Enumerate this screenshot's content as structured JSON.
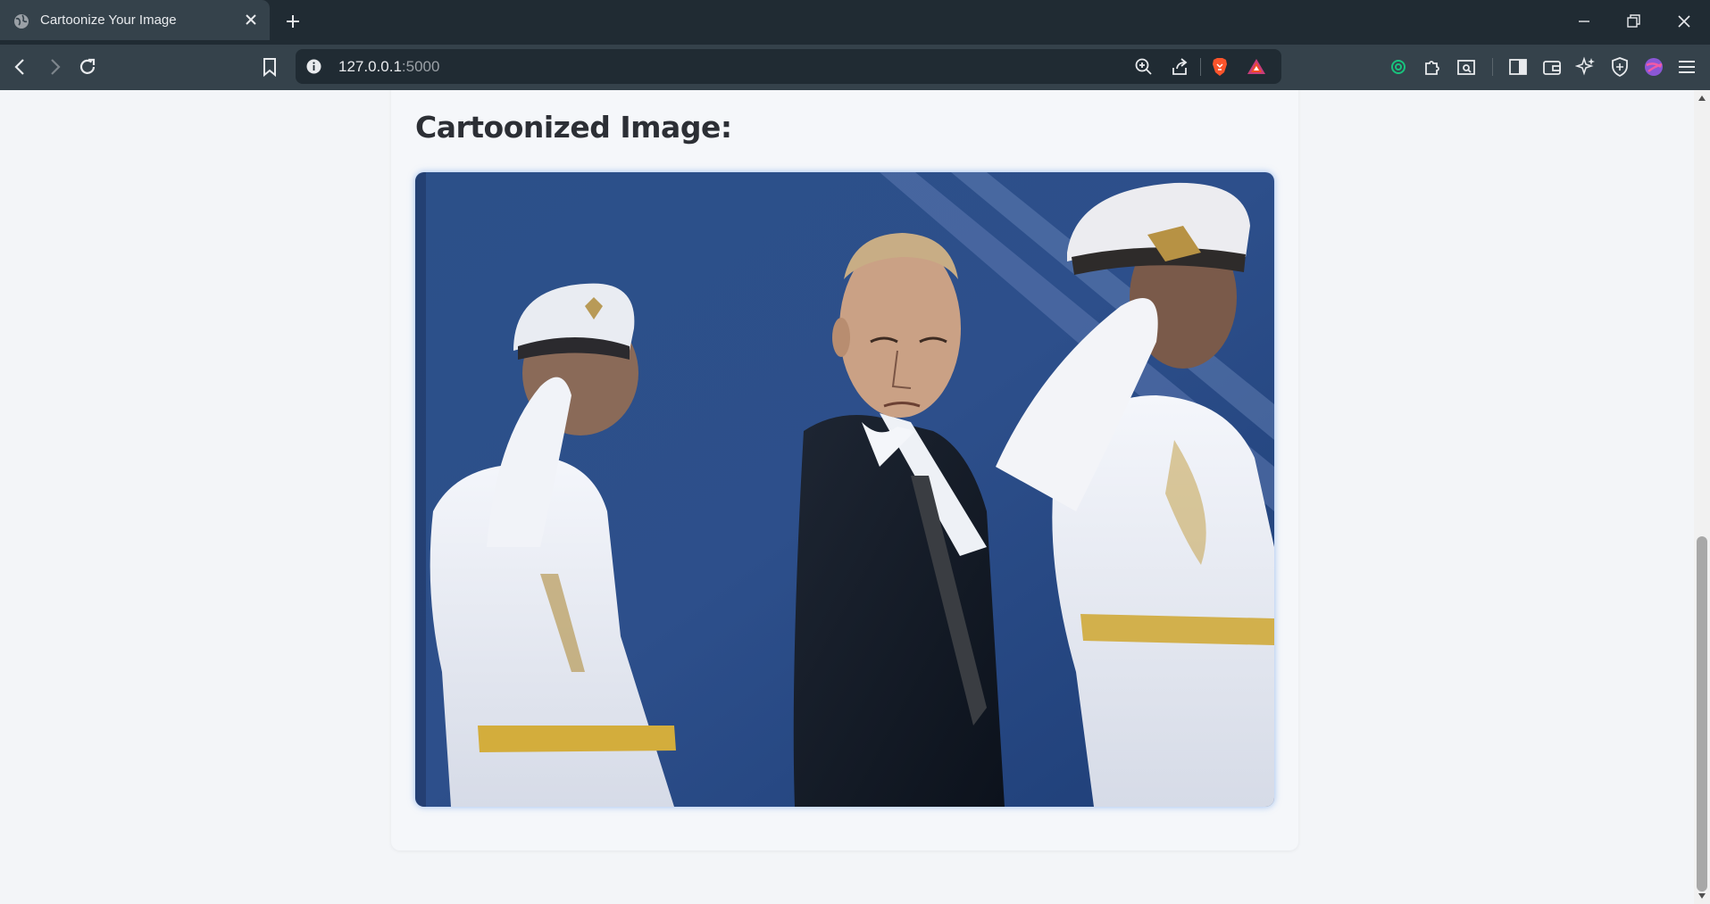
{
  "browser": {
    "tab_title": "Cartoonize Your Image",
    "url_host": "127.0.0.1",
    "url_port": ":5000",
    "toolbar_icons": [
      "back-icon",
      "forward-icon",
      "reload-icon",
      "bookmark-icon",
      "info-icon",
      "zoom-icon",
      "share-icon",
      "brave-shields-icon",
      "brave-rewards-icon",
      "chatgpt-extension-icon",
      "extensions-icon",
      "screenshot-icon",
      "sidebar-icon",
      "wallet-icon",
      "leo-ai-icon",
      "vpn-icon",
      "profile-icon",
      "menu-icon"
    ],
    "window_controls": [
      "minimize-icon",
      "restore-icon",
      "close-window-icon"
    ]
  },
  "page": {
    "heading": "Cartoonized Image:",
    "image_description_kind": "cartoonized-photo",
    "colors": {
      "accent_glow": "#5a8fe6",
      "heading": "#2c2f35",
      "page_bg": "#f3f5f8"
    }
  }
}
